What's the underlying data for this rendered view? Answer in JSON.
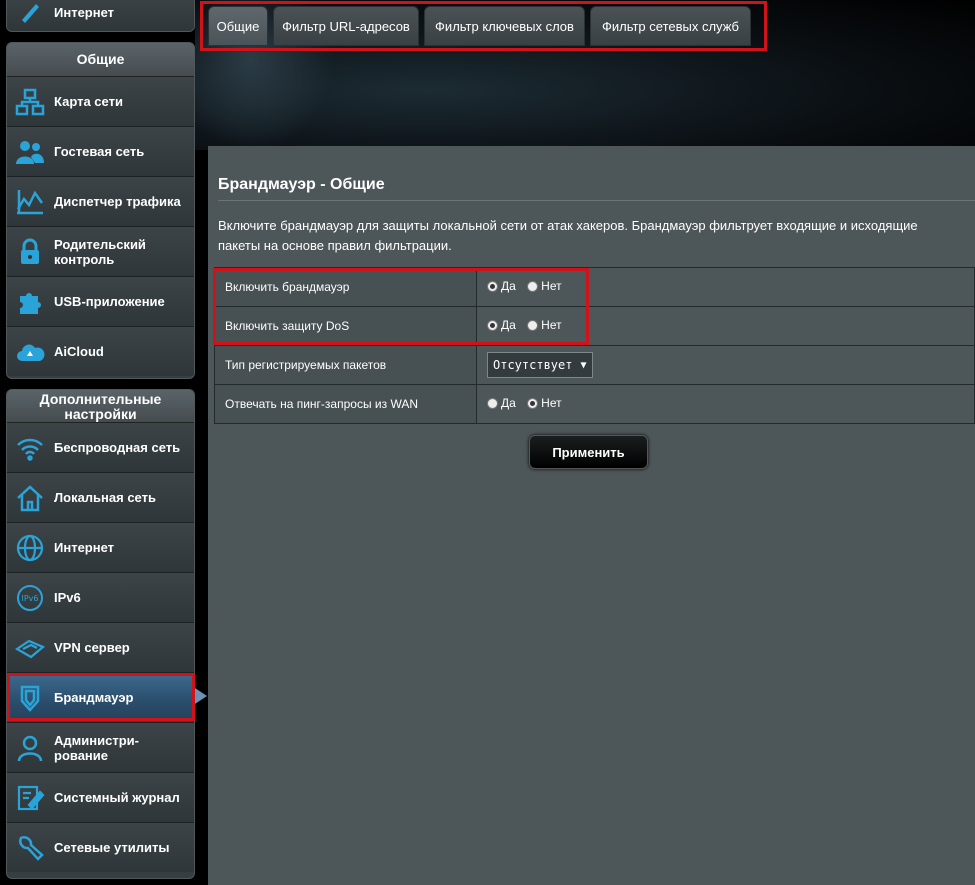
{
  "sidebar": {
    "top_item": {
      "label": "Интернет",
      "icon": "edit-icon"
    },
    "general": {
      "header": "Общие",
      "items": [
        {
          "label": "Карта сети",
          "icon": "network-map-icon"
        },
        {
          "label": "Гостевая сеть",
          "icon": "guest-network-icon"
        },
        {
          "label": "Диспетчер трафика",
          "icon": "traffic-manager-icon"
        },
        {
          "label": "Родительский контроль",
          "icon": "lock-icon"
        },
        {
          "label": "USB-приложение",
          "icon": "puzzle-icon"
        },
        {
          "label": "AiCloud",
          "icon": "cloud-icon"
        }
      ]
    },
    "advanced": {
      "header": "Дополнительные настройки",
      "items": [
        {
          "label": "Беспроводная сеть",
          "icon": "wifi-icon"
        },
        {
          "label": "Локальная сеть",
          "icon": "home-icon"
        },
        {
          "label": "Интернет",
          "icon": "globe-icon"
        },
        {
          "label": "IPv6",
          "icon": "ipv6-icon"
        },
        {
          "label": "VPN сервер",
          "icon": "vpn-icon"
        },
        {
          "label": "Брандмауэр",
          "icon": "shield-icon",
          "active": true
        },
        {
          "label": "Администри-рование",
          "icon": "admin-user-icon"
        },
        {
          "label": "Системный журнал",
          "icon": "system-log-icon"
        },
        {
          "label": "Сетевые утилиты",
          "icon": "wrench-icon"
        }
      ]
    }
  },
  "tabs": [
    {
      "label": "Общие",
      "active": true
    },
    {
      "label": "Фильтр URL-адресов"
    },
    {
      "label": "Фильтр ключевых слов"
    },
    {
      "label": "Фильтр сетевых служб"
    }
  ],
  "main": {
    "title": "Брандмауэр - Общие",
    "description": "Включите брандмауэр для защиты локальной сети от атак хакеров. Брандмауэр фильтрует входящие и исходящие пакеты на основе правил фильтрации.",
    "settings": {
      "enable_firewall": {
        "label": "Включить брандмауэр",
        "yes": "Да",
        "no": "Нет",
        "selected": "yes"
      },
      "enable_dos": {
        "label": "Включить защиту DoS",
        "yes": "Да",
        "no": "Нет",
        "selected": "yes"
      },
      "log_type": {
        "label": "Тип регистрируемых пакетов",
        "value": "Отсутствует"
      },
      "ping_wan": {
        "label": "Отвечать на пинг-запросы из WAN",
        "yes": "Да",
        "no": "Нет",
        "selected": "no"
      }
    },
    "apply_label": "Применить"
  },
  "colors": {
    "highlight": "#d0121b",
    "accent_icon": "#2aa4d8",
    "content_bg": "#4d5659"
  }
}
